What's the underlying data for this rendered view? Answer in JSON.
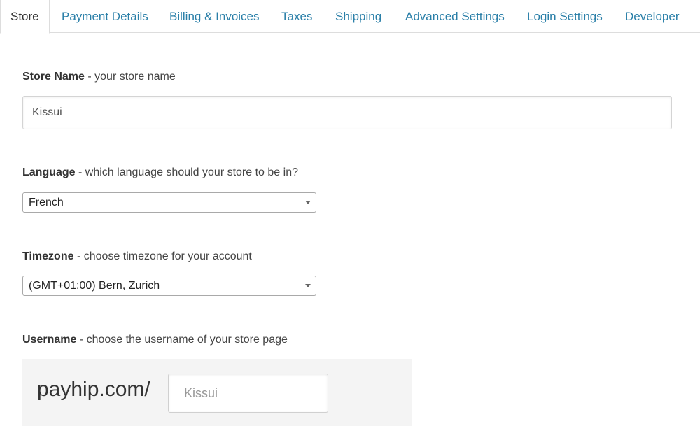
{
  "tabs": [
    {
      "label": "Store",
      "active": true
    },
    {
      "label": "Payment Details"
    },
    {
      "label": "Billing & Invoices"
    },
    {
      "label": "Taxes"
    },
    {
      "label": "Shipping"
    },
    {
      "label": "Advanced Settings"
    },
    {
      "label": "Login Settings"
    },
    {
      "label": "Developer"
    }
  ],
  "store_name": {
    "label": "Store Name",
    "hint": " - your store name",
    "value": "Kissui"
  },
  "language": {
    "label": "Language",
    "hint": " - which language should your store to be in?",
    "selected": "French"
  },
  "timezone": {
    "label": "Timezone",
    "hint": " - choose timezone for your account",
    "selected": "(GMT+01:00) Bern, Zurich"
  },
  "username": {
    "label": "Username",
    "hint": " - choose the username of your store page",
    "domain": "payhip.com/",
    "placeholder": "Kissui"
  },
  "colors": {
    "link": "#2a7fa8",
    "text": "#333333",
    "panel": "#f4f4f4"
  }
}
